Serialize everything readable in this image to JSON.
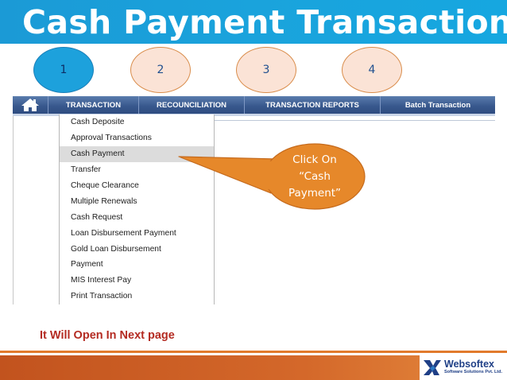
{
  "slide": {
    "title": "Cash Payment Transaction",
    "bottom_note": "It Will Open In Next page"
  },
  "steps": [
    "1",
    "2",
    "3",
    "4"
  ],
  "nav": {
    "home_icon": "home-icon",
    "tabs": [
      "TRANSACTION",
      "RECOUNCILIATION",
      "TRANSACTION REPORTS",
      "Batch Transaction"
    ]
  },
  "menu": {
    "items": [
      "Cash Deposite",
      "Approval Transactions",
      "Cash Payment",
      "Transfer",
      "Cheque Clearance",
      "Multiple Renewals",
      "Cash Request",
      "Loan Disbursement Payment",
      "Gold Loan Disbursement",
      "Payment",
      "MIS Interest Pay",
      "Print Transaction"
    ],
    "highlighted": "Cash Payment"
  },
  "callout": {
    "lines": [
      "Click On",
      "“Cash",
      "Payment”"
    ]
  },
  "logo": {
    "name": "Websoftex",
    "tagline": "Software Solutions Pvt. Ltd."
  },
  "colors": {
    "title_bar": "#1b9ad6",
    "nav_bar": "#39598e",
    "callout": "#e6882a",
    "active_step": "#1da1dc",
    "step": "#fbe3d6",
    "note_text": "#b42b22",
    "footer": "#d4682a"
  }
}
